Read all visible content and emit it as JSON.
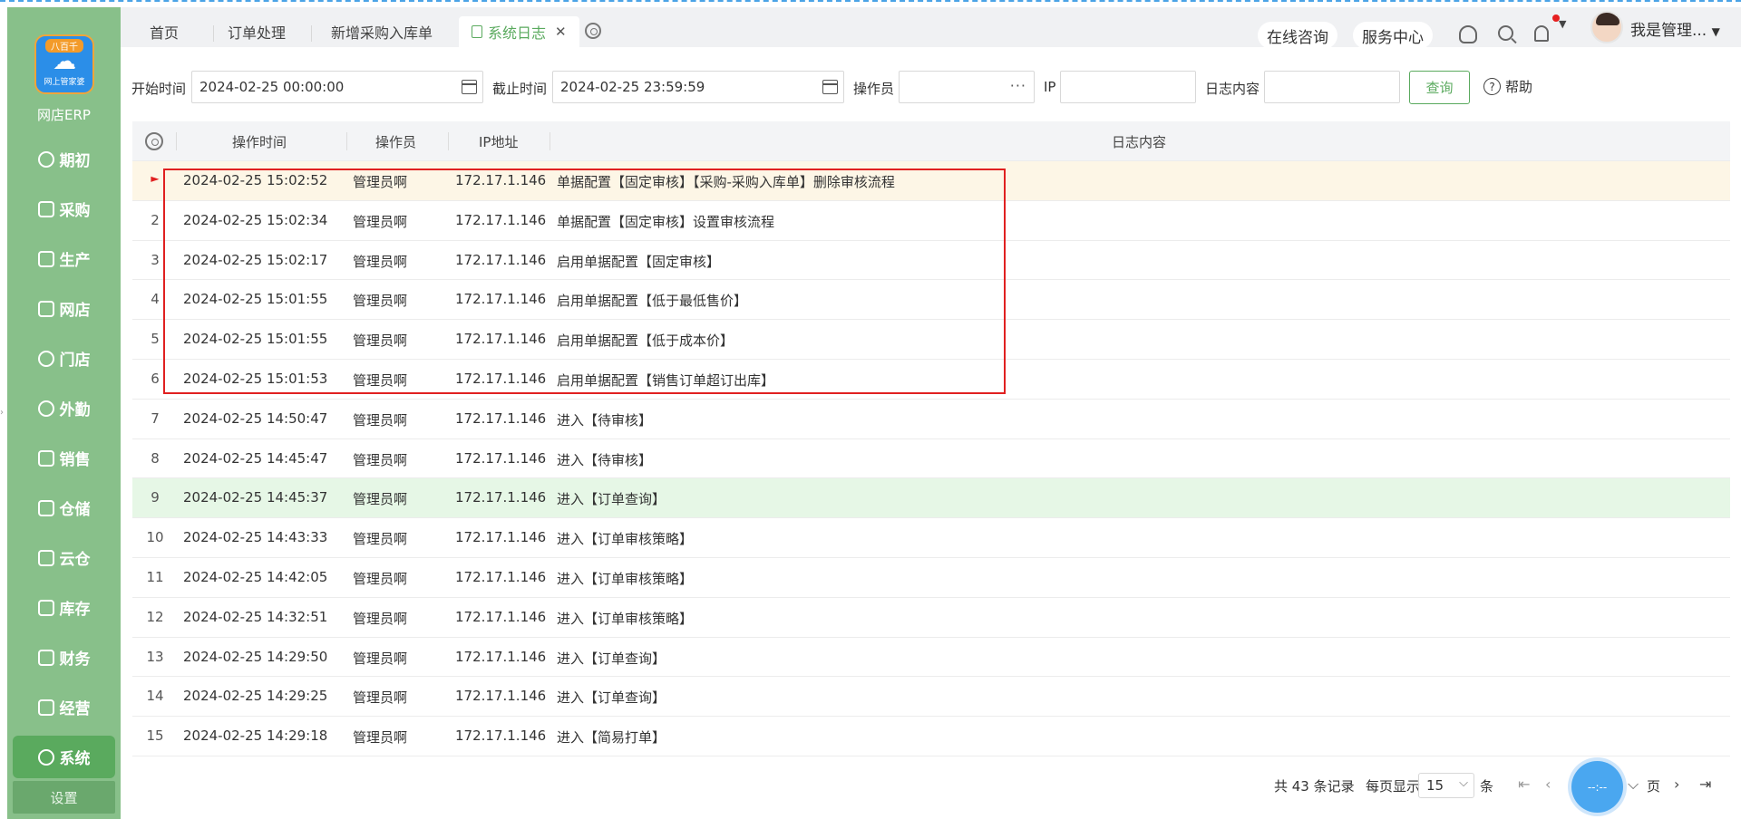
{
  "sidebar": {
    "logo_top": "八百千",
    "logo_sub": "网上管家婆",
    "app_name": "网店ERP",
    "items": [
      {
        "label": "期初",
        "icon": "circle-icon"
      },
      {
        "label": "采购",
        "icon": "cart-icon"
      },
      {
        "label": "生产",
        "icon": "factory-icon"
      },
      {
        "label": "网店",
        "icon": "shop-icon"
      },
      {
        "label": "门店",
        "icon": "pie-icon"
      },
      {
        "label": "外勤",
        "icon": "target-icon"
      },
      {
        "label": "销售",
        "icon": "bar-chart-icon"
      },
      {
        "label": "仓储",
        "icon": "warehouse-icon"
      },
      {
        "label": "云仓",
        "icon": "cloud-warehouse-icon"
      },
      {
        "label": "库存",
        "icon": "home-icon"
      },
      {
        "label": "财务",
        "icon": "wallet-icon"
      },
      {
        "label": "经营",
        "icon": "trend-icon"
      },
      {
        "label": "系统",
        "icon": "gear-icon"
      }
    ],
    "active": "系统",
    "settings": "设置"
  },
  "tabs": [
    {
      "label": "首页"
    },
    {
      "label": "订单处理"
    },
    {
      "label": "新增采购入库单"
    },
    {
      "label": "系统日志",
      "active": true
    }
  ],
  "header": {
    "consult": "在线咨询",
    "service": "服务中心",
    "user": "我是管理..."
  },
  "filter": {
    "start_label": "开始时间",
    "start_value": "2024-02-25 00:00:00",
    "end_label": "截止时间",
    "end_value": "2024-02-25 23:59:59",
    "operator_label": "操作员",
    "operator_value": "",
    "ip_label": "IP",
    "ip_value": "",
    "content_label": "日志内容",
    "content_value": "",
    "query_button": "查询",
    "help": "帮助"
  },
  "table": {
    "columns": [
      "操作时间",
      "操作员",
      "IP地址",
      "日志内容"
    ],
    "rows": [
      {
        "idx": "►",
        "time": "2024-02-25 15:02:52",
        "op": "管理员啊",
        "ip": "172.17.1.146",
        "log": "单据配置【固定审核】【采购-采购入库单】删除审核流程"
      },
      {
        "idx": "2",
        "time": "2024-02-25 15:02:34",
        "op": "管理员啊",
        "ip": "172.17.1.146",
        "log": "单据配置【固定审核】设置审核流程"
      },
      {
        "idx": "3",
        "time": "2024-02-25 15:02:17",
        "op": "管理员啊",
        "ip": "172.17.1.146",
        "log": "启用单据配置【固定审核】"
      },
      {
        "idx": "4",
        "time": "2024-02-25 15:01:55",
        "op": "管理员啊",
        "ip": "172.17.1.146",
        "log": "启用单据配置【低于最低售价】"
      },
      {
        "idx": "5",
        "time": "2024-02-25 15:01:55",
        "op": "管理员啊",
        "ip": "172.17.1.146",
        "log": "启用单据配置【低于成本价】"
      },
      {
        "idx": "6",
        "time": "2024-02-25 15:01:53",
        "op": "管理员啊",
        "ip": "172.17.1.146",
        "log": "启用单据配置【销售订单超订出库】"
      },
      {
        "idx": "7",
        "time": "2024-02-25 14:50:47",
        "op": "管理员啊",
        "ip": "172.17.1.146",
        "log": "进入【待审核】"
      },
      {
        "idx": "8",
        "time": "2024-02-25 14:45:47",
        "op": "管理员啊",
        "ip": "172.17.1.146",
        "log": "进入【待审核】"
      },
      {
        "idx": "9",
        "time": "2024-02-25 14:45:37",
        "op": "管理员啊",
        "ip": "172.17.1.146",
        "log": "进入【订单查询】"
      },
      {
        "idx": "10",
        "time": "2024-02-25 14:43:33",
        "op": "管理员啊",
        "ip": "172.17.1.146",
        "log": "进入【订单审核策略】"
      },
      {
        "idx": "11",
        "time": "2024-02-25 14:42:05",
        "op": "管理员啊",
        "ip": "172.17.1.146",
        "log": "进入【订单审核策略】"
      },
      {
        "idx": "12",
        "time": "2024-02-25 14:32:51",
        "op": "管理员啊",
        "ip": "172.17.1.146",
        "log": "进入【订单审核策略】"
      },
      {
        "idx": "13",
        "time": "2024-02-25 14:29:50",
        "op": "管理员啊",
        "ip": "172.17.1.146",
        "log": "进入【订单查询】"
      },
      {
        "idx": "14",
        "time": "2024-02-25 14:29:25",
        "op": "管理员啊",
        "ip": "172.17.1.146",
        "log": "进入【订单查询】"
      },
      {
        "idx": "15",
        "time": "2024-02-25 14:29:18",
        "op": "管理员啊",
        "ip": "172.17.1.146",
        "log": "进入【简易打单】"
      }
    ]
  },
  "pager": {
    "total": "共 43 条记录",
    "per_page_label": "每页显示",
    "per_page": "15",
    "unit": "条",
    "page_unit": "页",
    "float_text": "--:--"
  },
  "colors": {
    "sidebar": "#88c08a",
    "accent": "#5aaa5e",
    "highlight": "#e02020"
  }
}
